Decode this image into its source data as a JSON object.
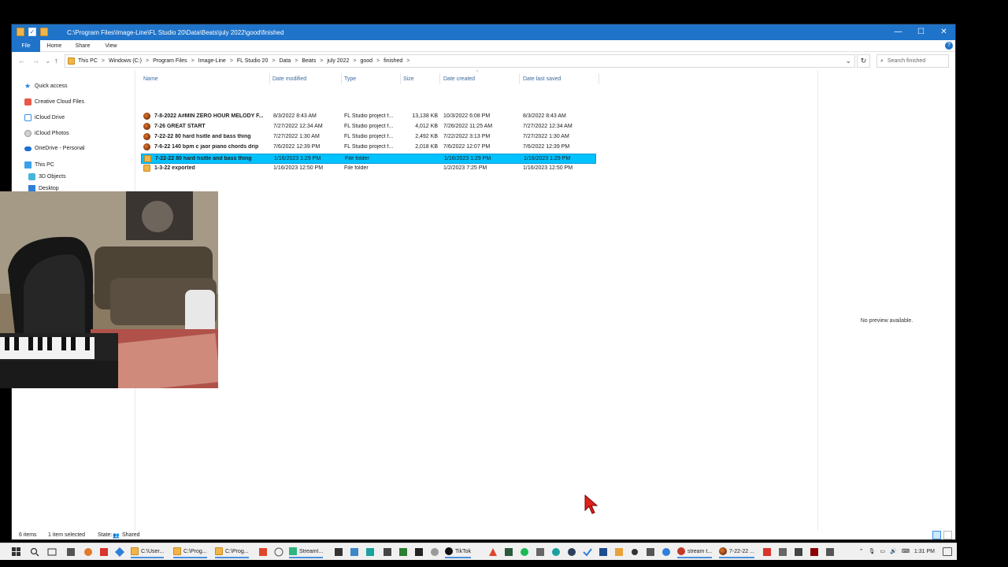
{
  "window": {
    "title_path": "C:\\Program Files\\Image-Line\\FL Studio 20\\Data\\Beats\\july 2022\\good\\finished",
    "controls": {
      "minimize": "—",
      "maximize": "☐",
      "close": "✕"
    }
  },
  "ribbon": {
    "tabs": [
      "File",
      "Home",
      "Share",
      "View"
    ],
    "help": "?"
  },
  "address": {
    "back": "←",
    "forward": "→",
    "recent": "⌄",
    "up": "↑",
    "crumbs": [
      "This PC",
      "Windows (C:)",
      "Program Files",
      "Image-Line",
      "FL Studio 20",
      "Data",
      "Beats",
      "july 2022",
      "good",
      "finished"
    ],
    "separator": ">",
    "dropdown": "⌄",
    "refresh": "↻",
    "search_placeholder": "Search finished",
    "search_icon": "⌕"
  },
  "nav": {
    "items": [
      {
        "label": "Quick access",
        "icon": "star-icon"
      },
      {
        "label": "Creative Cloud Files",
        "icon": "creative-cloud-icon"
      },
      {
        "label": "iCloud Drive",
        "icon": "icloud-drive-icon"
      },
      {
        "label": "iCloud Photos",
        "icon": "icloud-photos-icon"
      },
      {
        "label": "OneDrive - Personal",
        "icon": "onedrive-icon"
      },
      {
        "label": "This PC",
        "icon": "this-pc-icon"
      },
      {
        "label": "3D Objects",
        "icon": "3d-objects-icon"
      },
      {
        "label": "Desktop",
        "icon": "desktop-icon"
      }
    ]
  },
  "columns": {
    "name": "Name",
    "date_modified": "Date modified",
    "type": "Type",
    "size": "Size",
    "date_created": "Date created",
    "date_last_saved": "Date last saved"
  },
  "files": [
    {
      "name": "7-8-2022 A#MIN ZERO HOUR MELODY F...",
      "modified": "8/3/2022 8:43 AM",
      "type": "FL Studio project f...",
      "size": "13,138 KB",
      "created": "10/3/2022 6:08 PM",
      "saved": "8/3/2022 8:43 AM",
      "kind": "flp"
    },
    {
      "name": "7-26 GREAT START",
      "modified": "7/27/2022 12:34 AM",
      "type": "FL Studio project f...",
      "size": "4,012 KB",
      "created": "7/26/2022 11:25 AM",
      "saved": "7/27/2022 12:34 AM",
      "kind": "flp"
    },
    {
      "name": "7-22-22 80 hard hsitle and bass thing",
      "modified": "7/27/2022 1:30 AM",
      "type": "FL Studio project f...",
      "size": "2,492 KB",
      "created": "7/22/2022 3:13 PM",
      "saved": "7/27/2022 1:30 AM",
      "kind": "flp"
    },
    {
      "name": "7-6-22 140 bpm c jaor piano chords drip",
      "modified": "7/6/2022 12:39 PM",
      "type": "FL Studio project f...",
      "size": "2,018 KB",
      "created": "7/6/2022 12:07 PM",
      "saved": "7/6/2022 12:39 PM",
      "kind": "flp"
    },
    {
      "name": "7-22-22 80 hard hsitle and bass thing",
      "modified": "1/16/2023 1:29 PM",
      "type": "File folder",
      "size": "",
      "created": "1/16/2023 1:29 PM",
      "saved": "1/16/2023 1:29 PM",
      "kind": "folder",
      "selected": true
    },
    {
      "name": "1-3-22 exported",
      "modified": "1/16/2023 12:50 PM",
      "type": "File folder",
      "size": "",
      "created": "1/2/2023 7:25 PM",
      "saved": "1/16/2023 12:50 PM",
      "kind": "folder"
    }
  ],
  "preview": {
    "message": "No preview available."
  },
  "status": {
    "items": "6 items",
    "selected": "1 item selected",
    "state_label": "State:",
    "state_value": "Shared"
  },
  "taskbar": {
    "apps": [
      "C:\\User...",
      "C:\\Prog...",
      "C:\\Prog...",
      "StreamI...",
      "TikTok",
      "stream t...",
      "7-22-22 ..."
    ],
    "clock": "1:31 PM"
  },
  "colors": {
    "accent": "#1f73c9",
    "selection": "#00c2ff",
    "folder": "#f0b548",
    "cursor": "#e0201b"
  }
}
